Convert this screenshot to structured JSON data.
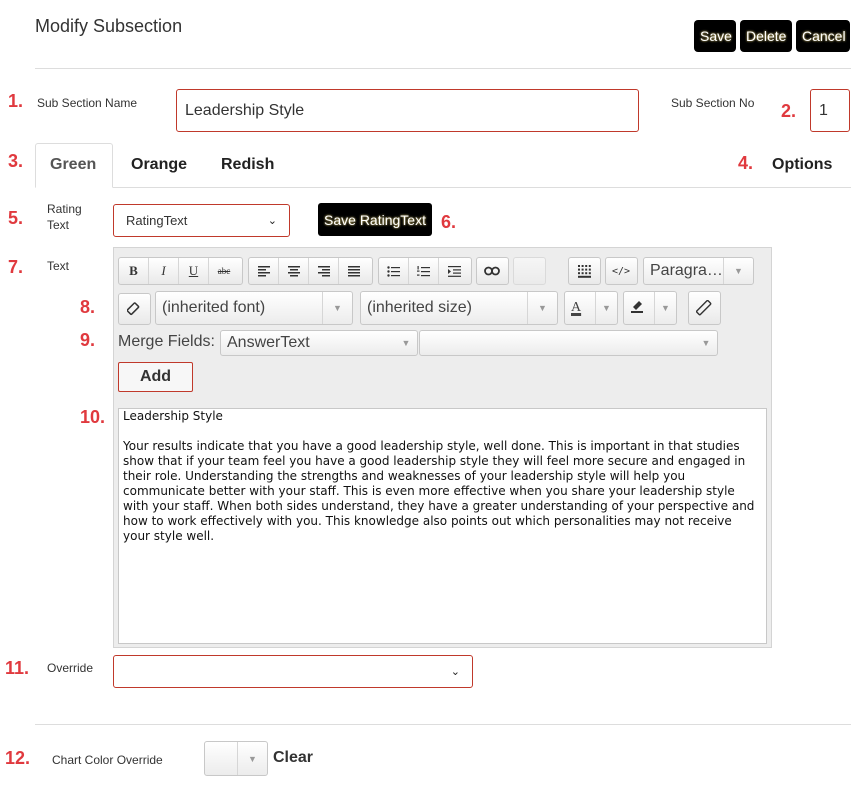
{
  "header": {
    "title": "Modify Subsection",
    "save_label": "Save",
    "delete_label": "Delete",
    "cancel_label": "Cancel"
  },
  "markers": [
    "1.",
    "2.",
    "3.",
    "4.",
    "5.",
    "6.",
    "7.",
    "8.",
    "9.",
    "10.",
    "11.",
    "12."
  ],
  "subsection": {
    "name_label": "Sub Section Name",
    "name_value": "Leadership Style",
    "no_label": "Sub Section No",
    "no_value": "1"
  },
  "tabs": {
    "green": "Green",
    "orange": "Orange",
    "redish": "Redish",
    "options": "Options"
  },
  "rating": {
    "label": "Rating Text",
    "selected": "RatingText",
    "save_label": "Save RatingText"
  },
  "text_label": "Text",
  "editor": {
    "format_dropdown": "Paragra…",
    "font_dropdown": "(inherited font)",
    "size_dropdown": "(inherited size)",
    "merge_label": "Merge Fields:",
    "merge_selected": "AnswerText",
    "merge_second": "",
    "add_label": "Add",
    "content_title": "Leadership Style",
    "content_body": "Your results indicate that you have a good leadership style, well done. This is important in that studies show that if your team feel you have a good leadership style they will feel more secure and engaged in their role. Understanding the strengths and weaknesses of your leadership style will help you communicate better with your staff. This is even more effective when you share your leadership style with your staff. When both sides understand, they have a greater understanding of your perspective and how to work effectively with you. This knowledge also points out which personalities may not receive your style well.",
    "toolbar_icons": [
      "bold-icon",
      "italic-icon",
      "underline-icon",
      "strikethrough-icon",
      "align-left-icon",
      "align-center-icon",
      "align-right-icon",
      "align-justify-icon",
      "bullet-list-icon",
      "numbered-list-icon",
      "indent-icon",
      "link-icon",
      "unlink-icon",
      "table-icon",
      "source-code-icon",
      "eraser-icon",
      "font-color-icon",
      "highlight-icon",
      "ruler-icon"
    ]
  },
  "override": {
    "label": "Override",
    "selected": ""
  },
  "chart_color": {
    "label": "Chart Color Override",
    "clear_label": "Clear"
  },
  "colors": {
    "accent_red": "#e0393e",
    "field_border": "#c0392b",
    "button_black": "#000000"
  }
}
